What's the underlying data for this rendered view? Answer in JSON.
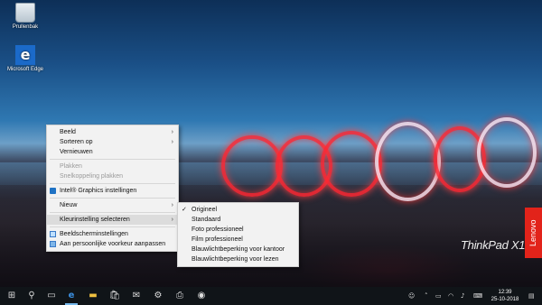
{
  "desktop": {
    "icons": [
      {
        "label": "Prullenbak",
        "icon": "recycle-bin-icon"
      },
      {
        "label": "Microsoft Edge",
        "icon": "edge-icon"
      }
    ],
    "brand": "ThinkPad X1",
    "oem_logo": "Lenovo"
  },
  "context_menu": {
    "items": [
      {
        "label": "Beeld",
        "submenu": true,
        "disabled": false
      },
      {
        "label": "Sorteren op",
        "submenu": true,
        "disabled": false
      },
      {
        "label": "Vernieuwen",
        "submenu": false,
        "disabled": false
      },
      {
        "label": "Plakken",
        "submenu": false,
        "disabled": true
      },
      {
        "label": "Snelkoppeling plakken",
        "submenu": false,
        "disabled": true
      },
      {
        "label": "Intel® Graphics instellingen",
        "submenu": false,
        "disabled": false,
        "icon": "intel-graphics-icon"
      },
      {
        "label": "Nieuw",
        "submenu": true,
        "disabled": false
      },
      {
        "label": "Kleurinstelling selecteren",
        "submenu": true,
        "disabled": false,
        "highlighted": true
      },
      {
        "label": "Beeldscherminstellingen",
        "submenu": false,
        "disabled": false,
        "icon": "display-settings-icon"
      },
      {
        "label": "Aan persoonlijke voorkeur aanpassen",
        "submenu": false,
        "disabled": false,
        "icon": "personalize-icon"
      }
    ]
  },
  "color_submenu": {
    "items": [
      {
        "label": "Origineel",
        "checked": true
      },
      {
        "label": "Standaard",
        "checked": false
      },
      {
        "label": "Foto professioneel",
        "checked": false
      },
      {
        "label": "Film professioneel",
        "checked": false
      },
      {
        "label": "Blauwlichtbeperking voor kantoor",
        "checked": false
      },
      {
        "label": "Blauwlichtbeperking voor lezen",
        "checked": false
      }
    ],
    "check_glyph": "✓"
  },
  "taskbar": {
    "buttons": [
      "start-icon",
      "search-icon",
      "task-view-icon",
      "edge-icon",
      "file-explorer-icon",
      "store-icon",
      "mail-icon",
      "settings-icon",
      "printer-icon",
      "app-icon"
    ],
    "tray_icons": [
      "people-icon",
      "chevron-up-icon",
      "battery-icon",
      "network-icon",
      "volume-icon",
      "keyboard-icon"
    ],
    "time": "12:39",
    "date": "25-10-2018"
  },
  "colors": {
    "accent": "#76b9ed",
    "menu_bg": "#f2f2f2",
    "lenovo_red": "#e2231a"
  }
}
